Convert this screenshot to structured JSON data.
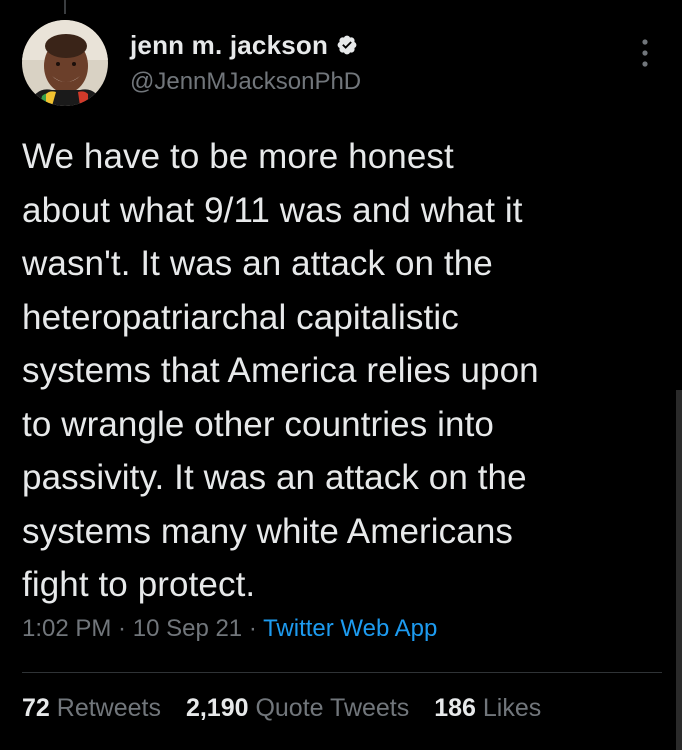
{
  "author": {
    "display_name": "jenn m. jackson",
    "handle": "@JennMJacksonPhD",
    "verified_icon": "verified-badge-icon",
    "avatar_icon": "profile-photo"
  },
  "tweet": {
    "lines": [
      "We have to be more honest",
      "about what 9/11 was and what it",
      "wasn't. It was an attack on the",
      "heteropatriarchal capitalistic",
      "systems that America relies upon",
      "to wrangle other countries into",
      "passivity. It was an attack on the",
      "systems many white Americans",
      "fight to protect."
    ]
  },
  "meta": {
    "time": "1:02 PM",
    "dot1": " · ",
    "date": "10 Sep 21",
    "dot2": " · ",
    "source": "Twitter Web App"
  },
  "stats": {
    "retweets_count": "72",
    "retweets_label": "Retweets",
    "quotes_count": "2,190",
    "quotes_label": "Quote Tweets",
    "likes_count": "186",
    "likes_label": "Likes"
  },
  "colors": {
    "background": "#000000",
    "text": "#e7e9ea",
    "secondary": "#71767b",
    "link": "#1d9bf0"
  }
}
